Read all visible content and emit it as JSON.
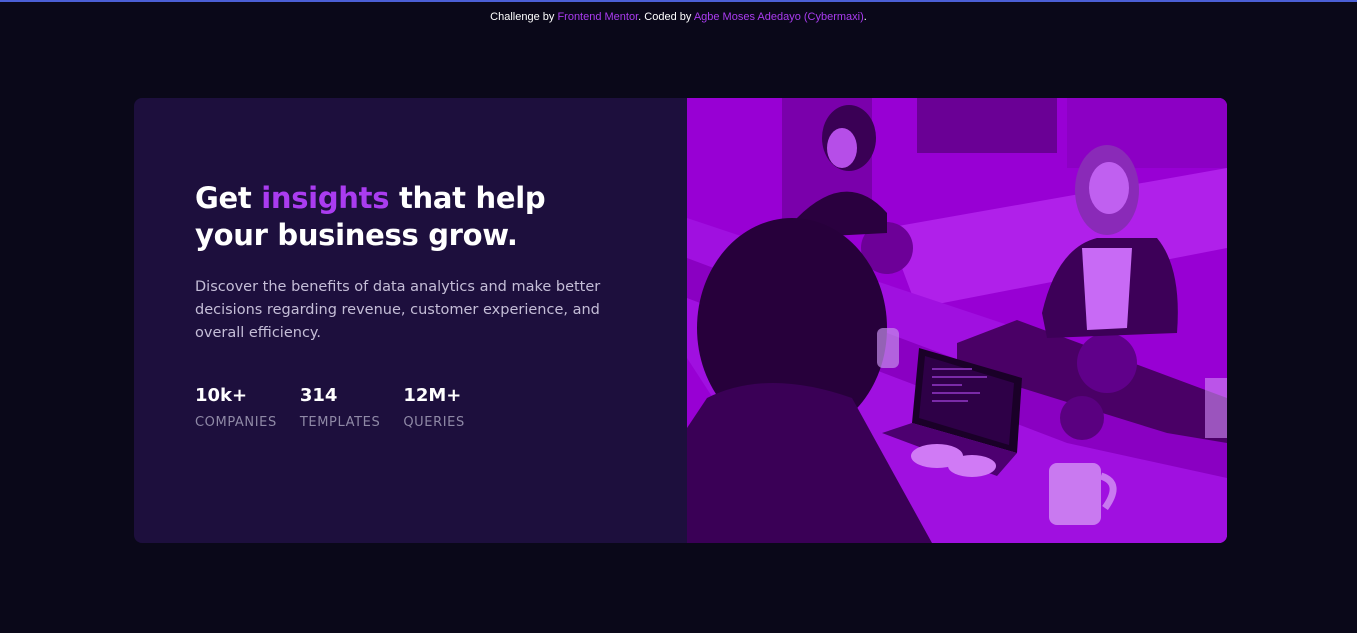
{
  "attribution": {
    "prefix": "Challenge by ",
    "challenge_link": "Frontend Mentor",
    "middle": ". Coded by ",
    "author_link": "Agbe Moses Adedayo (Cybermaxi)",
    "suffix": "."
  },
  "card": {
    "headline_start": "Get ",
    "headline_accent": "insights",
    "headline_end": " that help your business grow.",
    "description": "Discover the benefits of data analytics and make better decisions regarding revenue, customer experience, and overall efficiency.",
    "stats": [
      {
        "value": "10k+",
        "label": "COMPANIES"
      },
      {
        "value": "314",
        "label": "TEMPLATES"
      },
      {
        "value": "12M+",
        "label": "QUERIES"
      }
    ]
  },
  "colors": {
    "page_bg": "#0a0819",
    "card_bg": "#1d0f3d",
    "accent": "#aa3cf0",
    "image_overlay": "#9a00d6"
  },
  "image": {
    "icon": "office-team-photo"
  }
}
